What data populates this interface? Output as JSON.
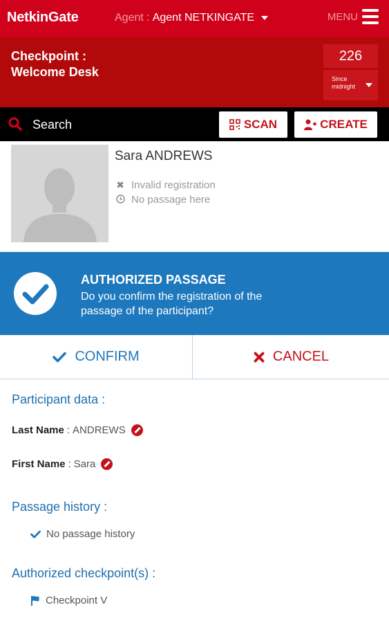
{
  "header": {
    "logo": "NetkinGate",
    "agent_prefix": "Agent :",
    "agent_name": "Agent NETKINGATE",
    "menu_label": "MENU"
  },
  "checkpoint": {
    "label_line1": "Checkpoint :",
    "label_line2": "Welcome Desk",
    "count": "226",
    "count_sub_line1": "Since",
    "count_sub_line2": "midnight"
  },
  "searchbar": {
    "search_label": "Search",
    "scan_label": "SCAN",
    "create_label": "CREATE"
  },
  "participant": {
    "name": "Sara ANDREWS",
    "status_registration": "Invalid registration",
    "status_passage": "No passage here"
  },
  "banner": {
    "title": "AUTHORIZED PASSAGE",
    "text": "Do you confirm the registration of the passage of the participant?"
  },
  "actions": {
    "confirm_label": "CONFIRM",
    "cancel_label": "CANCEL"
  },
  "participant_data": {
    "title": "Participant data :",
    "last_name_label": "Last Name",
    "last_name_value": "ANDREWS",
    "first_name_label": "First Name",
    "first_name_value": "Sara",
    "separator": ":"
  },
  "passage_history": {
    "title": "Passage history :",
    "item": "No passage history"
  },
  "authorized_checkpoints": {
    "title": "Authorized checkpoint(s) :",
    "item": "Checkpoint V"
  },
  "colors": {
    "header_red": "#d0021b",
    "band_red": "#b20a0a",
    "accent_blue": "#1d78bd",
    "cancel_red": "#c4121a"
  },
  "icons": {
    "menu": "hamburger-icon",
    "search": "search-icon",
    "scan": "qr-code-icon",
    "create": "add-user-icon",
    "confirm": "check-icon",
    "cancel": "close-icon",
    "edit": "edit-icon",
    "flag": "flag-icon"
  }
}
